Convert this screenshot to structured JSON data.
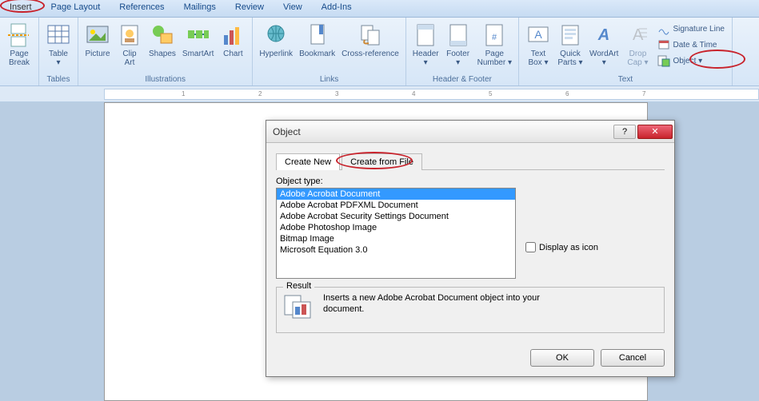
{
  "tabs": {
    "insert": "Insert",
    "pageLayout": "Page Layout",
    "references": "References",
    "mailings": "Mailings",
    "review": "Review",
    "view": "View",
    "addins": "Add-Ins"
  },
  "ribbon": {
    "pages": {
      "pageBreak": "Page\nBreak",
      "group": ""
    },
    "tables": {
      "table": "Table\n▾",
      "group": "Tables"
    },
    "illustrations": {
      "picture": "Picture",
      "clipArt": "Clip\nArt",
      "shapes": "Shapes",
      "smartArt": "SmartArt",
      "chart": "Chart",
      "group": "Illustrations"
    },
    "links": {
      "hyperlink": "Hyperlink",
      "bookmark": "Bookmark",
      "crossRef": "Cross-reference",
      "group": "Links"
    },
    "headerFooter": {
      "header": "Header\n▾",
      "footer": "Footer\n▾",
      "pageNum": "Page\nNumber ▾",
      "group": "Header & Footer"
    },
    "text": {
      "textBox": "Text\nBox ▾",
      "quickParts": "Quick\nParts ▾",
      "wordArt": "WordArt\n▾",
      "dropCap": "Drop\nCap ▾",
      "signature": "Signature Line",
      "dateTime": "Date & Time",
      "object": "Object ▾",
      "group": "Text"
    }
  },
  "dialog": {
    "title": "Object",
    "tabCreateNew": "Create New",
    "tabCreateFromFile": "Create from File",
    "objectTypeLabel": "Object type:",
    "options": [
      "Adobe Acrobat Document",
      "Adobe Acrobat PDFXML Document",
      "Adobe Acrobat Security Settings Document",
      "Adobe Photoshop Image",
      "Bitmap Image",
      "Microsoft Equation 3.0"
    ],
    "displayAsIcon": "Display as icon",
    "resultLegend": "Result",
    "resultText": "Inserts a new Adobe Acrobat Document object into your document.",
    "ok": "OK",
    "cancel": "Cancel",
    "help": "?",
    "close": "✕"
  },
  "ruler": {
    "marks": [
      "1",
      "2",
      "3",
      "4",
      "5",
      "6",
      "7"
    ]
  }
}
